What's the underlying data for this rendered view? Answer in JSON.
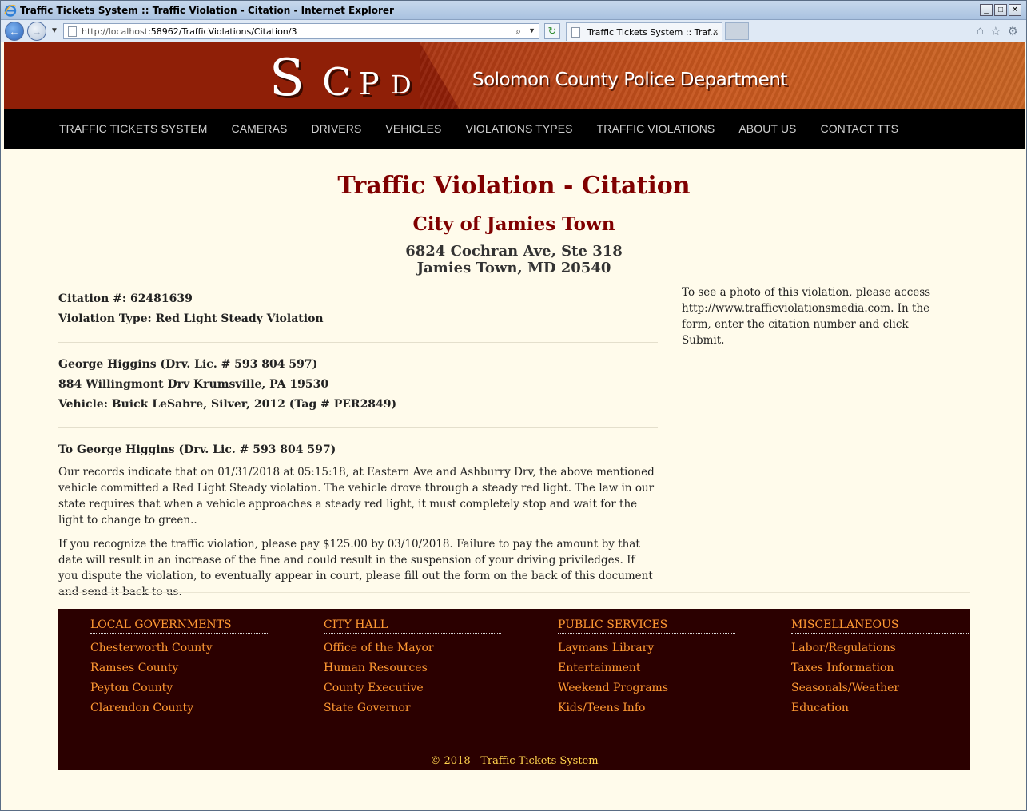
{
  "browser": {
    "window_title": "Traffic Tickets System :: Traffic Violation - Citation - Internet Explorer",
    "url_host": "http://localhost",
    "url_rest": ":58962/TrafficViolations/Citation/3",
    "tab_label": "Traffic Tickets System :: Traf...",
    "win_minimize": "_",
    "win_maximize": "□",
    "win_close": "✕"
  },
  "banner": {
    "logo": [
      "S",
      "C",
      "P",
      "D"
    ],
    "department": "Solomon County Police Department"
  },
  "menu": {
    "items": [
      "TRAFFIC TICKETS SYSTEM",
      "CAMERAS",
      "DRIVERS",
      "VEHICLES",
      "VIOLATIONS TYPES",
      "TRAFFIC VIOLATIONS",
      "ABOUT US",
      "CONTACT TTS"
    ]
  },
  "citation": {
    "title": "Traffic Violation - Citation",
    "city": "City of Jamies Town",
    "address_line1": "6824 Cochran Ave, Ste 318",
    "address_line2": "Jamies Town, MD 20540",
    "citation_number": "Citation #: 62481639",
    "violation_type": "Violation Type: Red Light Steady Violation",
    "driver_name": "George Higgins (Drv. Lic. # 593 804 597)",
    "driver_address": "884 Willingmont Drv Krumsville, PA 19530",
    "vehicle": "Vehicle: Buick LeSabre, Silver, 2012 (Tag # PER2849)",
    "to_line": "To George Higgins (Drv. Lic. # 593 804 597)",
    "paragraph1": "Our records indicate that on 01/31/2018 at 05:15:18, at Eastern Ave and Ashburry Drv, the above mentioned vehicle committed a Red Light Steady violation. The vehicle drove through a steady red light. The law in our state requires that when a vehicle approaches a steady red light, it must completely stop and wait for the light to change to green..",
    "paragraph2": "If you recognize the traffic violation, please pay $125.00 by 03/10/2018. Failure to pay the amount by that date will result in an increase of the fine and could result in the suspension of your driving priviledges. If you dispute the violation, to eventually appear in court, please fill out the form on the back of this document and send it back to us.",
    "photo_note": "To see a photo of this violation, please access http://www.trafficviolationsmedia.com. In the form, enter the citation number and click Submit."
  },
  "footer": {
    "columns": [
      {
        "heading": "LOCAL GOVERNMENTS",
        "links": [
          "Chesterworth County",
          "Ramses County",
          "Peyton County",
          "Clarendon County"
        ]
      },
      {
        "heading": "CITY HALL",
        "links": [
          "Office of the Mayor",
          "Human Resources",
          "County Executive",
          "State Governor"
        ]
      },
      {
        "heading": "PUBLIC SERVICES",
        "links": [
          "Laymans Library",
          "Entertainment",
          "Weekend Programs",
          "Kids/Teens Info"
        ]
      },
      {
        "heading": "MISCELLANEOUS",
        "links": [
          "Labor/Regulations",
          "Taxes Information",
          "Seasonals/Weather",
          "Education"
        ]
      }
    ],
    "copyright": "© 2018 - Traffic Tickets System"
  },
  "colors": {
    "accent": "#800000",
    "footer_bg": "#2b0000",
    "footer_link": "#ff9933",
    "copyright": "#ffd24d"
  }
}
